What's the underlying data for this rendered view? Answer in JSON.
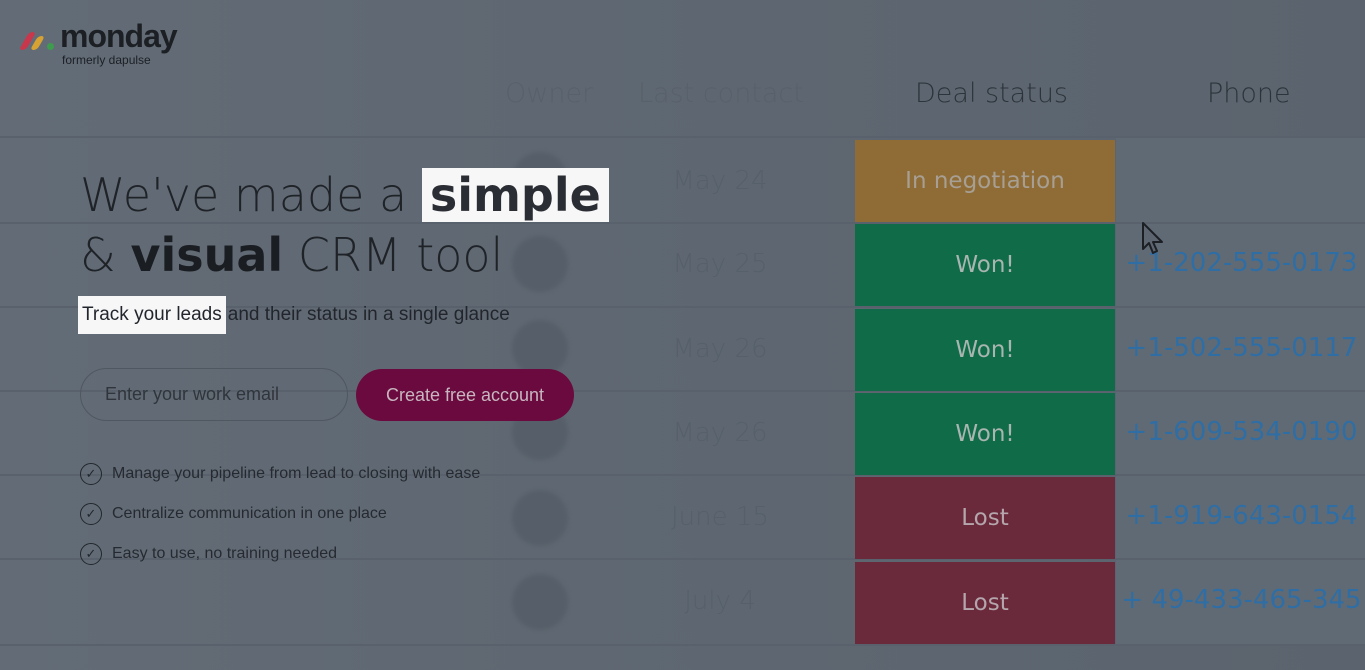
{
  "brand": {
    "name": "monday",
    "tagline": "formerly dapulse",
    "colors": {
      "red": "#c8374c",
      "yellow": "#d6a234",
      "green": "#3e9c4f"
    }
  },
  "hero": {
    "headline_part1": "We've made a",
    "headline_highlight": "simple",
    "headline_part2_prefix": "&",
    "headline_bold": "visual",
    "headline_part2_suffix": "CRM tool",
    "sub_highlight": "Track your leads",
    "sub_rest": "and their status in a single glance"
  },
  "signup": {
    "email_placeholder": "Enter your work email",
    "cta_label": "Create free account",
    "cta_color": "#6b0a3e"
  },
  "features": [
    {
      "text": "Manage your pipeline from lead to closing with ease",
      "icon": "check-circle-icon"
    },
    {
      "text": "Centralize communication in one place",
      "icon": "check-circle-icon"
    },
    {
      "text": "Easy to use, no training needed",
      "icon": "check-circle-icon"
    }
  ],
  "table": {
    "headers": {
      "owner": "Owner",
      "contact": "Last contact",
      "status": "Deal status",
      "phone": "Phone"
    },
    "rows": [
      {
        "date": "May 24",
        "status": "In negotiation",
        "status_type": "neg",
        "phone": ""
      },
      {
        "date": "May 25",
        "status": "Won!",
        "status_type": "won",
        "phone": "+1-202-555-0173"
      },
      {
        "date": "May 26",
        "status": "Won!",
        "status_type": "won",
        "phone": "+1-502-555-0117"
      },
      {
        "date": "May 26",
        "status": "Won!",
        "status_type": "won",
        "phone": "+1-609-534-0190"
      },
      {
        "date": "June 15",
        "status": "Lost",
        "status_type": "lost",
        "phone": "+1-919-643-0154"
      },
      {
        "date": "July 4",
        "status": "Lost",
        "status_type": "lost",
        "phone": "+ 49-433-465-345"
      }
    ]
  }
}
